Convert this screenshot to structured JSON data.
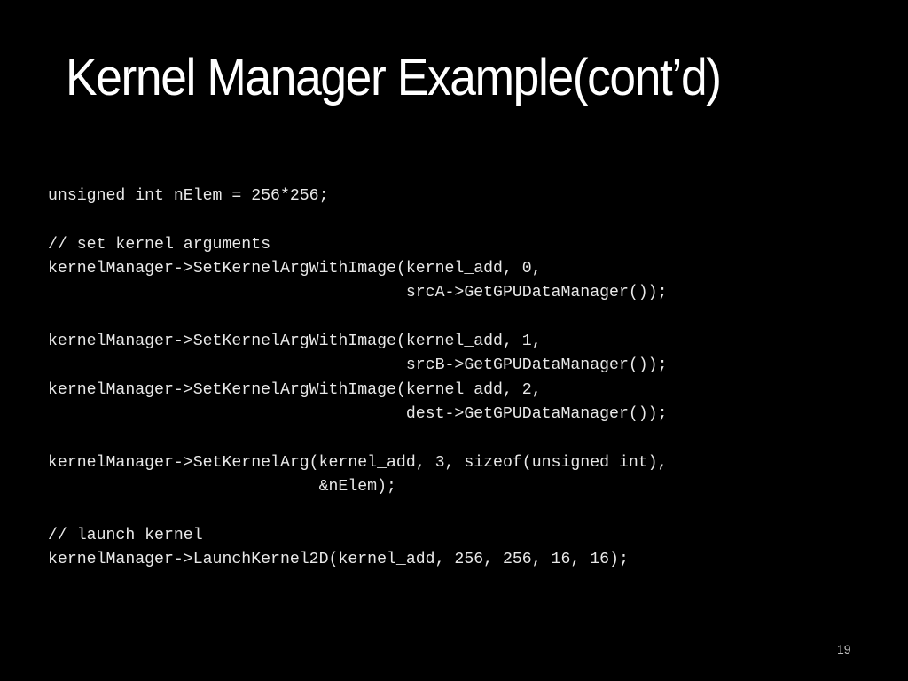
{
  "slide": {
    "title": "Kernel Manager Example(cont’d)",
    "code_lines": [
      "unsigned int nElem = 256*256;",
      "",
      "// set kernel arguments",
      "kernelManager->SetKernelArgWithImage(kernel_add, 0,",
      "                                     srcA->GetGPUDataManager());",
      "",
      "kernelManager->SetKernelArgWithImage(kernel_add, 1,",
      "                                     srcB->GetGPUDataManager());",
      "kernelManager->SetKernelArgWithImage(kernel_add, 2,",
      "                                     dest->GetGPUDataManager());",
      "",
      "kernelManager->SetKernelArg(kernel_add, 3, sizeof(unsigned int),",
      "                            &nElem);",
      "",
      "// launch kernel",
      "kernelManager->LaunchKernel2D(kernel_add, 256, 256, 16, 16);"
    ],
    "page_number": "19"
  },
  "colors": {
    "background": "#000000",
    "title_text": "#ffffff",
    "code_text": "#e8e8e8",
    "page_number_text": "#bfbfbf"
  }
}
